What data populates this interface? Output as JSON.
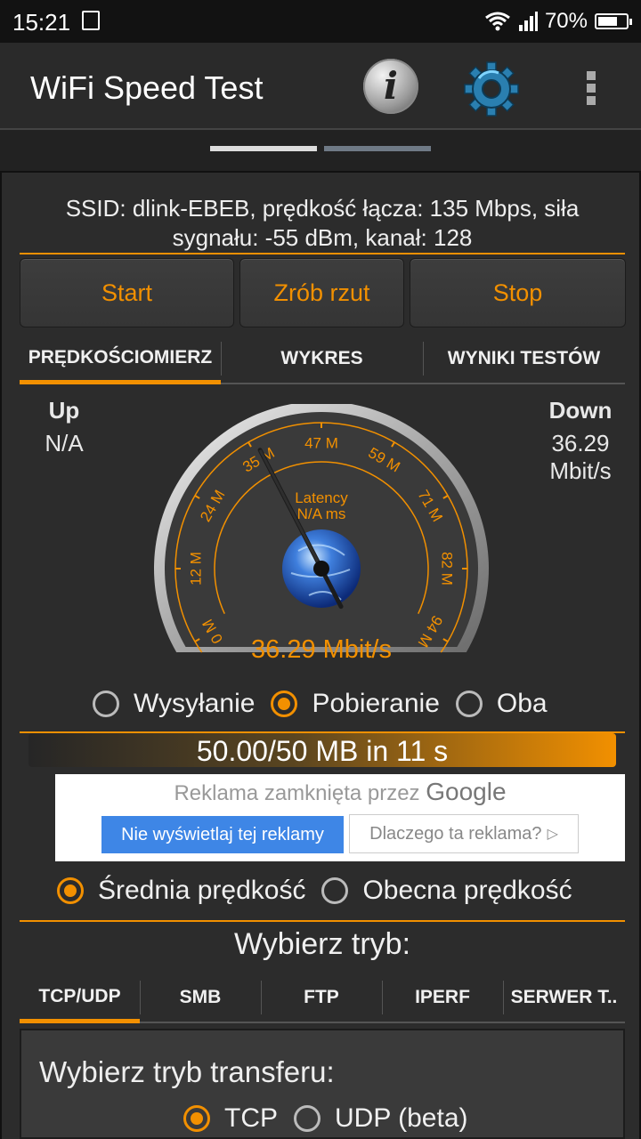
{
  "status_bar": {
    "time": "15:21",
    "battery_pct": "70%",
    "battery_level": 0.7
  },
  "app_bar": {
    "title": "WiFi Speed Test",
    "icons": [
      "info-icon",
      "gear-icon",
      "more-vert-icon"
    ]
  },
  "pager": {
    "pages": 2,
    "active_page": 1
  },
  "network_info": "SSID: dlink-EBEB, prędkość łącza: 135 Mbps, siła sygnału: -55 dBm, kanał: 128",
  "controls": {
    "start": "Start",
    "capture": "Zrób rzut",
    "stop": "Stop"
  },
  "tabs": [
    {
      "label": "PRĘDKOŚCIOMIERZ",
      "active": true
    },
    {
      "label": "WYKRES",
      "active": false
    },
    {
      "label": "WYNIKI TESTÓW",
      "active": false
    }
  ],
  "up": {
    "label": "Up",
    "value": "N/A"
  },
  "down": {
    "label": "Down",
    "value": "36.29",
    "unit": "Mbit/s"
  },
  "gauge": {
    "ticks": [
      "0 M",
      "12 M",
      "24 M",
      "35 M",
      "47 M",
      "59 M",
      "71 M",
      "82 M",
      "94 M"
    ],
    "latency_label": "Latency",
    "latency_value": "N/A ms",
    "reading": "36.29 Mbit/s",
    "needle_value": 36.29,
    "max": 94
  },
  "direction": {
    "options": [
      {
        "label": "Wysyłanie",
        "selected": false
      },
      {
        "label": "Pobieranie",
        "selected": true
      },
      {
        "label": "Oba",
        "selected": false
      }
    ]
  },
  "progress": {
    "text": "50.00/50 MB in 11 s",
    "fraction": 1.0
  },
  "ad": {
    "closed_text": "Reklama zamknięta przez",
    "brand": "Google",
    "hide_button": "Nie wyświetlaj tej reklamy",
    "why_button": "Dlaczego ta reklama?"
  },
  "speed_mode": {
    "options": [
      {
        "label": "Średnia prędkość",
        "selected": true
      },
      {
        "label": "Obecna prędkość",
        "selected": false
      }
    ]
  },
  "mode_title": "Wybierz tryb:",
  "mode_tabs": [
    {
      "label": "TCP/UDP",
      "active": true
    },
    {
      "label": "SMB",
      "active": false
    },
    {
      "label": "FTP",
      "active": false
    },
    {
      "label": "IPERF",
      "active": false
    },
    {
      "label": "SERWER T..",
      "active": false
    }
  ],
  "transfer": {
    "title": "Wybierz tryb transferu:",
    "options": [
      {
        "label": "TCP",
        "selected": true
      },
      {
        "label": "UDP (beta)",
        "selected": false
      }
    ]
  },
  "colors": {
    "accent": "#f29000",
    "ad_button": "#3e86e6"
  }
}
